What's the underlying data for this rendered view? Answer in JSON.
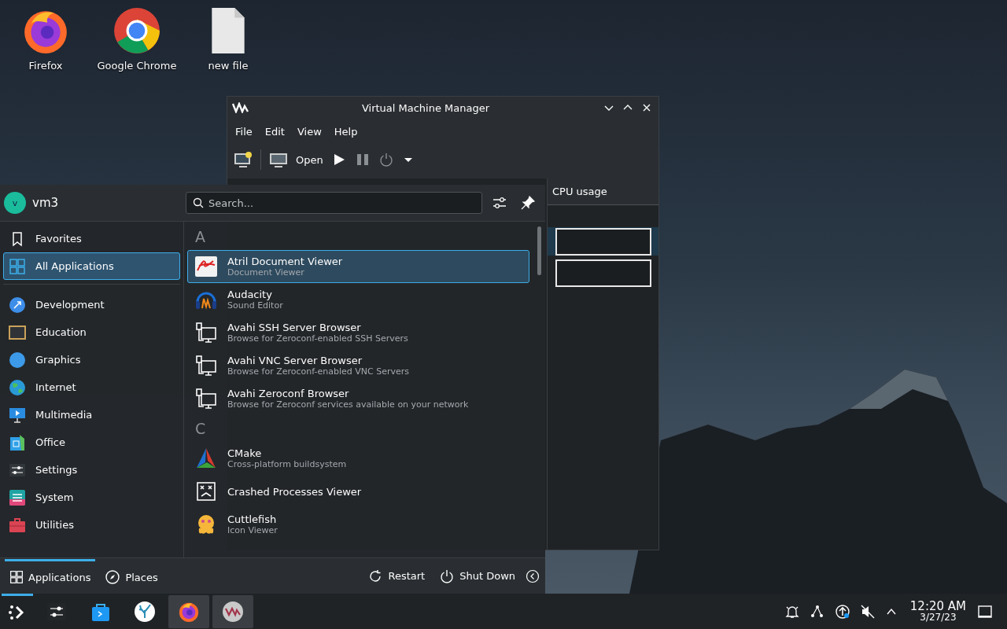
{
  "desktop_icons": [
    {
      "label": "Firefox",
      "kind": "firefox"
    },
    {
      "label": "Google Chrome",
      "kind": "chrome"
    },
    {
      "label": "new file",
      "kind": "file"
    }
  ],
  "vmm_window": {
    "title": "Virtual Machine Manager",
    "menu": [
      "File",
      "Edit",
      "View",
      "Help"
    ],
    "open_label": "Open",
    "column_header": "CPU usage"
  },
  "launcher": {
    "avatar_letter": "v",
    "user": "vm3",
    "search": {
      "placeholder": "Search..."
    },
    "categories": [
      {
        "label": "Favorites",
        "kind": "bookmark",
        "selected": false
      },
      {
        "label": "All Applications",
        "kind": "grid",
        "selected": true
      },
      {
        "label": "Development",
        "kind": "development",
        "selected": false
      },
      {
        "label": "Education",
        "kind": "education",
        "selected": false
      },
      {
        "label": "Graphics",
        "kind": "graphics",
        "selected": false
      },
      {
        "label": "Internet",
        "kind": "internet",
        "selected": false
      },
      {
        "label": "Multimedia",
        "kind": "multimedia",
        "selected": false
      },
      {
        "label": "Office",
        "kind": "office",
        "selected": false
      },
      {
        "label": "Settings",
        "kind": "settings",
        "selected": false
      },
      {
        "label": "System",
        "kind": "system",
        "selected": false
      },
      {
        "label": "Utilities",
        "kind": "utilities",
        "selected": false
      }
    ],
    "sections": [
      {
        "letter": "A",
        "apps": [
          {
            "name": "Atril Document Viewer",
            "description": "Document Viewer",
            "kind": "atril",
            "selected": true
          },
          {
            "name": "Audacity",
            "description": "Sound Editor",
            "kind": "audacity",
            "selected": false
          },
          {
            "name": "Avahi SSH Server Browser",
            "description": "Browse for Zeroconf-enabled SSH Servers",
            "kind": "network",
            "selected": false
          },
          {
            "name": "Avahi VNC Server Browser",
            "description": "Browse for Zeroconf-enabled VNC Servers",
            "kind": "network",
            "selected": false
          },
          {
            "name": "Avahi Zeroconf Browser",
            "description": "Browse for Zeroconf services available on your network",
            "kind": "network",
            "selected": false
          }
        ]
      },
      {
        "letter": "C",
        "apps": [
          {
            "name": "CMake",
            "description": "Cross-platform buildsystem",
            "kind": "cmake",
            "selected": false
          },
          {
            "name": "Crashed Processes Viewer",
            "kind": "crash",
            "selected": false
          },
          {
            "name": "Cuttlefish",
            "description": "Icon Viewer",
            "kind": "cuttlefish",
            "selected": false
          }
        ]
      }
    ],
    "footer_tabs": [
      {
        "label": "Applications",
        "kind": "grid",
        "selected": true
      },
      {
        "label": "Places",
        "kind": "compass",
        "selected": false
      }
    ],
    "actions": [
      {
        "label": "Restart",
        "kind": "restart"
      },
      {
        "label": "Shut Down",
        "kind": "power"
      }
    ]
  },
  "taskbar": {
    "launcher_open": true,
    "tasks": [
      {
        "kind": "settings",
        "active": false
      },
      {
        "kind": "discover",
        "active": false
      },
      {
        "kind": "coral",
        "active": false
      },
      {
        "kind": "firefox",
        "active": true
      },
      {
        "kind": "vmm",
        "active": true
      }
    ],
    "clock": {
      "time": "12:20 AM",
      "date": "3/27/23"
    }
  }
}
